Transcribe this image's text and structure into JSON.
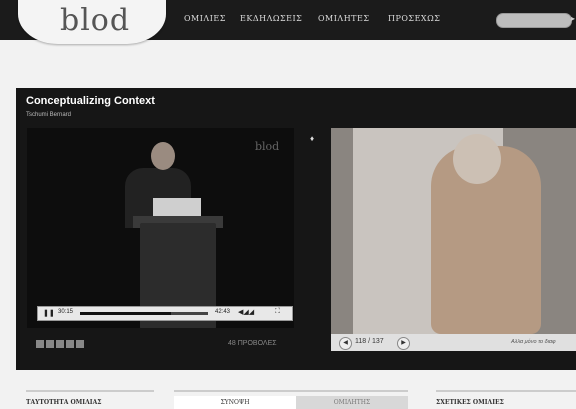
{
  "brand": {
    "logo": "blod"
  },
  "nav": {
    "items": [
      "ΟΜΙΛΙΕΣ",
      "ΕΚΔΗΛΩΣΕΙΣ",
      "ΟΜΙΛΗΤΕΣ",
      "ΠΡΟΣΕΧΩΣ"
    ]
  },
  "talk": {
    "title": "Conceptualizing Context",
    "speaker": "Tschumi Bernard"
  },
  "video": {
    "watermark": "blod",
    "current_time": "30:15",
    "duration": "42:43",
    "progress_fraction": 0.71,
    "views": "48 ΠΡΟΒΟΛΕΣ",
    "share_icons": [
      "facebook-icon",
      "twitter-icon",
      "share-icon",
      "email-icon",
      "plus-icon"
    ]
  },
  "slides": {
    "counter": "118 / 137",
    "sync_text": "Αλλα μόνο το διαφ"
  },
  "sections": {
    "identity": "ΤΑΥΤΟΤΗΤΑ ΟΜΙΛΙΑΣ",
    "summary_tab": "ΣΥΝΟΨΗ",
    "speaker_tab": "ΟΜΙΛΗΤΗΣ",
    "related": "ΣΧΕΤΙΚΕΣ ΟΜΙΛΙΕΣ"
  },
  "colors": {
    "topbar": "#1b1b1b",
    "panel": "#161616",
    "page": "#f2f2f2"
  }
}
